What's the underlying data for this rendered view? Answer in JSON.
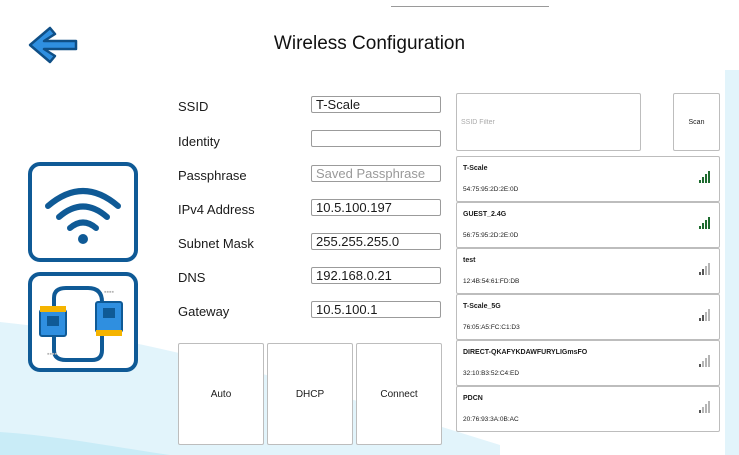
{
  "header": {
    "title": "Wireless Configuration"
  },
  "colors": {
    "accent": "#2f8fe0",
    "icon_border": "#0f5a96",
    "signal_strong": "#1e6b2f",
    "signal_weak": "#b5b5b5"
  },
  "form": {
    "fields": [
      {
        "label": "SSID",
        "value": "T-Scale",
        "placeholder": ""
      },
      {
        "label": "Identity",
        "value": "",
        "placeholder": ""
      },
      {
        "label": "Passphrase",
        "value": "",
        "placeholder": "Saved Passphrase"
      },
      {
        "label": "IPv4 Address",
        "value": "10.5.100.197",
        "placeholder": ""
      },
      {
        "label": "Subnet Mask",
        "value": "255.255.255.0",
        "placeholder": ""
      },
      {
        "label": "DNS",
        "value": "192.168.0.21",
        "placeholder": ""
      },
      {
        "label": "Gateway",
        "value": "10.5.100.1",
        "placeholder": ""
      }
    ]
  },
  "actions": {
    "auto_label": "Auto",
    "dhcp_label": "DHCP",
    "connect_label": "Connect"
  },
  "scan_panel": {
    "filter_placeholder": "SSID Filter",
    "filter_value": "",
    "scan_label": "Scan"
  },
  "networks": [
    {
      "ssid": "T-Scale",
      "bssid": "54:75:95:2D:2E:0D",
      "signal": 4
    },
    {
      "ssid": "GUEST_2.4G",
      "bssid": "56:75:95:2D:2E:0D",
      "signal": 4
    },
    {
      "ssid": "test",
      "bssid": "12:4B:54:61:FD:DB",
      "signal": 2
    },
    {
      "ssid": "T-Scale_5G",
      "bssid": "76:05:A5:FC:C1:D3",
      "signal": 2
    },
    {
      "ssid": "DIRECT-QKAFYKDAWFURYLIGmsFO",
      "bssid": "32:10:B3:52:C4:ED",
      "signal": 1
    },
    {
      "ssid": "PDCN",
      "bssid": "20:76:93:3A:0B:AC",
      "signal": 1
    }
  ]
}
